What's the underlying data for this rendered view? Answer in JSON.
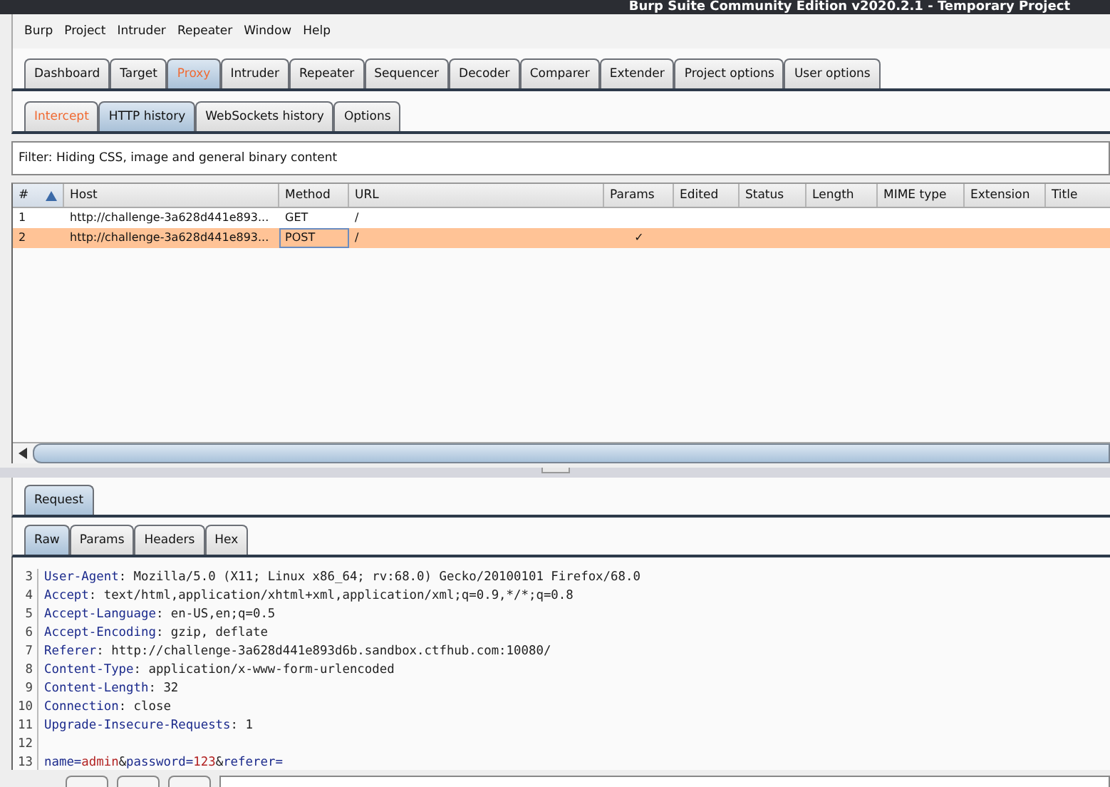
{
  "window": {
    "title": "Burp Suite Community Edition v2020.2.1 - Temporary Project"
  },
  "menu": [
    "Burp",
    "Project",
    "Intruder",
    "Repeater",
    "Window",
    "Help"
  ],
  "tabs": [
    {
      "label": "Dashboard",
      "selected": false,
      "highlighted": false
    },
    {
      "label": "Target",
      "selected": false,
      "highlighted": false
    },
    {
      "label": "Proxy",
      "selected": true,
      "highlighted": true
    },
    {
      "label": "Intruder",
      "selected": false,
      "highlighted": false
    },
    {
      "label": "Repeater",
      "selected": false,
      "highlighted": false
    },
    {
      "label": "Sequencer",
      "selected": false,
      "highlighted": false
    },
    {
      "label": "Decoder",
      "selected": false,
      "highlighted": false
    },
    {
      "label": "Comparer",
      "selected": false,
      "highlighted": false
    },
    {
      "label": "Extender",
      "selected": false,
      "highlighted": false
    },
    {
      "label": "Project options",
      "selected": false,
      "highlighted": false
    },
    {
      "label": "User options",
      "selected": false,
      "highlighted": false
    }
  ],
  "subtabs": [
    {
      "label": "Intercept",
      "selected": false,
      "highlighted": true
    },
    {
      "label": "HTTP history",
      "selected": true,
      "highlighted": false
    },
    {
      "label": "WebSockets history",
      "selected": false,
      "highlighted": false
    },
    {
      "label": "Options",
      "selected": false,
      "highlighted": false
    }
  ],
  "filter": "Filter: Hiding CSS, image and general binary content",
  "table": {
    "columns": [
      {
        "label": "#",
        "sorted": true
      },
      {
        "label": "Host",
        "sorted": false
      },
      {
        "label": "Method",
        "sorted": false
      },
      {
        "label": "URL",
        "sorted": false
      },
      {
        "label": "Params",
        "sorted": false
      },
      {
        "label": "Edited",
        "sorted": false
      },
      {
        "label": "Status",
        "sorted": false
      },
      {
        "label": "Length",
        "sorted": false
      },
      {
        "label": "MIME type",
        "sorted": false
      },
      {
        "label": "Extension",
        "sorted": false
      },
      {
        "label": "Title",
        "sorted": false
      }
    ],
    "rows": [
      {
        "number": "1",
        "host": "http://challenge-3a628d441e893...",
        "method": "GET",
        "url": "/",
        "selected": false
      },
      {
        "number": "2",
        "host": "http://challenge-3a628d441e893...",
        "method": "POST",
        "url": "/",
        "params": "✓",
        "selected": true
      }
    ]
  },
  "message_tabs": [
    {
      "label": "Request",
      "selected": true
    }
  ],
  "view_tabs": [
    {
      "label": "Raw",
      "selected": true
    },
    {
      "label": "Params",
      "selected": false
    },
    {
      "label": "Headers",
      "selected": false
    },
    {
      "label": "Hex",
      "selected": false
    }
  ],
  "lines": [
    {
      "number": "3",
      "segments": [
        {
          "text": "User-Agent",
          "kind": "name"
        },
        {
          "text": ": Mozilla/5.0 (X11; Linux x86_64; rv:68.0) Gecko/20100101 Firefox/68.0",
          "kind": "plain"
        }
      ]
    },
    {
      "number": "4",
      "segments": [
        {
          "text": "Accept",
          "kind": "name"
        },
        {
          "text": ": text/html,application/xhtml+xml,application/xml;q=0.9,*/*;q=0.8",
          "kind": "plain"
        }
      ]
    },
    {
      "number": "5",
      "segments": [
        {
          "text": "Accept-Language",
          "kind": "name"
        },
        {
          "text": ": en-US,en;q=0.5",
          "kind": "plain"
        }
      ]
    },
    {
      "number": "6",
      "segments": [
        {
          "text": "Accept-Encoding",
          "kind": "name"
        },
        {
          "text": ": gzip, deflate",
          "kind": "plain"
        }
      ]
    },
    {
      "number": "7",
      "segments": [
        {
          "text": "Referer",
          "kind": "name"
        },
        {
          "text": ": http://challenge-3a628d441e893d6b.sandbox.ctfhub.com:10080/",
          "kind": "plain"
        }
      ]
    },
    {
      "number": "8",
      "segments": [
        {
          "text": "Content-Type",
          "kind": "name"
        },
        {
          "text": ": application/x-www-form-urlencoded",
          "kind": "plain"
        }
      ]
    },
    {
      "number": "9",
      "segments": [
        {
          "text": "Content-Length",
          "kind": "name"
        },
        {
          "text": ": 32",
          "kind": "plain"
        }
      ]
    },
    {
      "number": "10",
      "segments": [
        {
          "text": "Connection",
          "kind": "name"
        },
        {
          "text": ": close",
          "kind": "plain"
        }
      ]
    },
    {
      "number": "11",
      "segments": [
        {
          "text": "Upgrade-Insecure-Requests",
          "kind": "name"
        },
        {
          "text": ": 1",
          "kind": "plain"
        }
      ]
    },
    {
      "number": "12"
    },
    {
      "number": "13",
      "segments": [
        {
          "text": "name",
          "kind": "name"
        },
        {
          "text": "=",
          "kind": "name"
        },
        {
          "text": "admin",
          "kind": "value"
        },
        {
          "text": "&",
          "kind": "plain"
        },
        {
          "text": "password",
          "kind": "name"
        },
        {
          "text": "=",
          "kind": "name"
        },
        {
          "text": "123",
          "kind": "value"
        },
        {
          "text": "&",
          "kind": "plain"
        },
        {
          "text": "referer",
          "kind": "name"
        },
        {
          "text": "=",
          "kind": "name"
        }
      ]
    }
  ]
}
